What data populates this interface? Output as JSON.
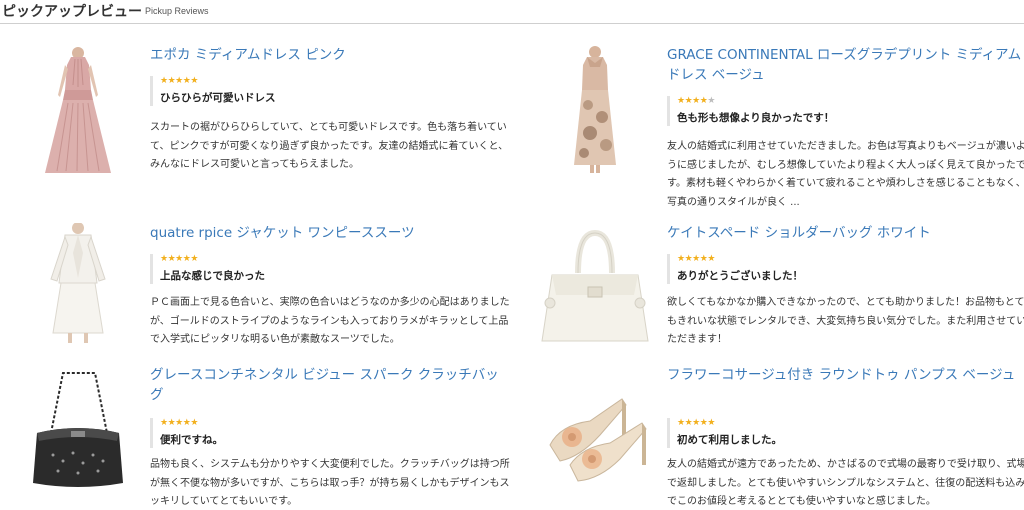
{
  "header": {
    "title": "ピックアップレビュー",
    "subtitle": "Pickup Reviews"
  },
  "colors": {
    "link": "#3a79b8",
    "star": "#f2b01e",
    "star_empty": "#bdbdbd"
  },
  "reviews": [
    {
      "product_title": "エポカ ミディアムドレス ピンク",
      "rating": 5,
      "headline": "ひらひらが可愛いドレス",
      "body": "スカートの裾がひらひらしていて、とても可愛いドレスです。色も落ち着いていて、ピンクですが可愛くなり過ぎず良かったです。友達の結婚式に着ていくと、みんなにドレス可愛いと言ってもらえました。",
      "image_icon": "pink-dress-icon"
    },
    {
      "product_title": "GRACE CONTINENTAL ローズグラデプリント ミディアムドレス ベージュ",
      "rating": 4,
      "headline": "色も形も想像より良かったです！",
      "body": "友人の結婚式に利用させていただきました。お色は写真よりもベージュが濃いように感じましたが、むしろ想像していたより程よく大人っぽく見えて良かったです。素材も軽くやわらかく着ていて疲れることや煩わしさを感じることもなく、写真の通りスタイルが良く ...",
      "image_icon": "beige-dress-icon"
    },
    {
      "product_title": "quatre rpice ジャケット ワンピーススーツ",
      "rating": 5,
      "headline": "上品な感じで良かった",
      "body": "ＰＣ画面上で見る色合いと、実際の色合いはどうなのか多少の心配はありましたが、ゴールドのストライプのようなラインも入っておりラメがキラッとして上品で入学式にピッタリな明るい色が素敵なスーツでした。",
      "image_icon": "white-suit-icon"
    },
    {
      "product_title": "ケイトスペード ショルダーバッグ ホワイト",
      "rating": 5,
      "headline": "ありがとうございました！",
      "body": "欲しくてもなかなか購入できなかったので、とても助かりました！お品物もとてもきれいな状態でレンタルでき、大変気持ち良い気分でした。また利用させていただきます！",
      "image_icon": "white-handbag-icon"
    },
    {
      "product_title": "グレースコンチネンタル ビジュー スパーク クラッチバッグ",
      "rating": 5,
      "headline": "便利ですね。",
      "body": "品物も良く、システムも分かりやすく大変便利でした。クラッチバッグは持つ所が無く不便な物が多いですが、こちらは取っ手？が持ち易くしかもデザインもスッキリしていてとてもいいです。",
      "image_icon": "black-clutch-icon"
    },
    {
      "product_title": "フラワーコサージュ付き ラウンドトゥ パンプス ベージュ",
      "rating": 5,
      "headline": "初めて利用しました。",
      "body": "友人の結婚式が遠方であったため、かさばるので式場の最寄りで受け取り、式場で返却しました。とても使いやすいシンプルなシステムと、往復の配送料も込みでこのお値段と考えるととても使いやすいなと感じました。",
      "image_icon": "beige-pumps-icon"
    }
  ]
}
